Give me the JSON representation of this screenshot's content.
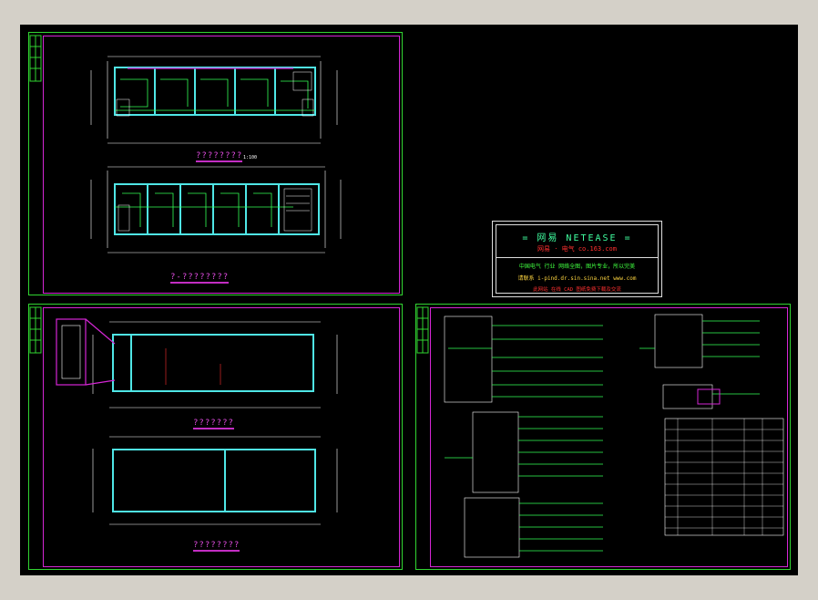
{
  "drawing_titles": {
    "top_left": "????????",
    "top_left_b": "?-????????",
    "bottom_left_a": "???????",
    "bottom_left_b": "????????"
  },
  "stamp": {
    "line1": "= 网易  NETEASE =",
    "line2": "网易 · 电气    co.163.com",
    "line3": "中国电气 行业 网络全图，图片专业，所以完美",
    "line4": "请联系  i-pind.dr.sin.sina.net www.com",
    "line5": "此网站 在线 CAD 图纸免费下载及交流"
  },
  "colors": {
    "background": "#000000",
    "frame": "#31d531",
    "title": "#e14ce1",
    "wall": "#4fe6e6",
    "wiring": "#33ff55"
  }
}
